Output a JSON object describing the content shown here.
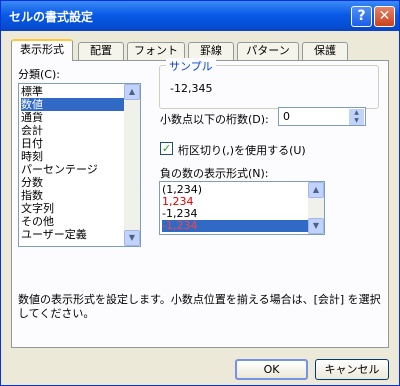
{
  "window": {
    "title": "セルの書式設定"
  },
  "tabs": [
    {
      "label": "表示形式"
    },
    {
      "label": "配置"
    },
    {
      "label": "フォント"
    },
    {
      "label": "罫線"
    },
    {
      "label": "パターン"
    },
    {
      "label": "保護"
    }
  ],
  "category": {
    "label": "分類(C):",
    "items": [
      "標準",
      "数値",
      "通貨",
      "会計",
      "日付",
      "時刻",
      "パーセンテージ",
      "分数",
      "指数",
      "文字列",
      "その他",
      "ユーザー定義"
    ],
    "selected": "数値"
  },
  "sample": {
    "label": "サンプル",
    "value": "-12,345"
  },
  "decimal": {
    "label": "小数点以下の桁数(D):",
    "value": "0"
  },
  "separator": {
    "label": "桁区切り(,)を使用する(U)",
    "checked": true
  },
  "negative": {
    "label": "負の数の表示形式(N):",
    "items": [
      {
        "text": "(1,234)",
        "red": false
      },
      {
        "text": "1,234",
        "red": true
      },
      {
        "text": "-1,234",
        "red": false
      },
      {
        "text": "-1,234",
        "red": true
      }
    ],
    "selected_index": 3
  },
  "description": "数値の表示形式を設定します。小数点位置を揃える場合は、[会計] を選択してください。",
  "buttons": {
    "ok": "OK",
    "cancel": "キャンセル"
  },
  "icons": {
    "help": "help-icon",
    "close": "close-icon",
    "check": "check-icon",
    "scroll_up": "chevron-up-icon",
    "scroll_down": "chevron-down-icon"
  },
  "colors": {
    "titlebar": "#0a5ae8",
    "selection": "#316ac5",
    "negative_red": "#e00000",
    "accent": "#0046d5"
  }
}
